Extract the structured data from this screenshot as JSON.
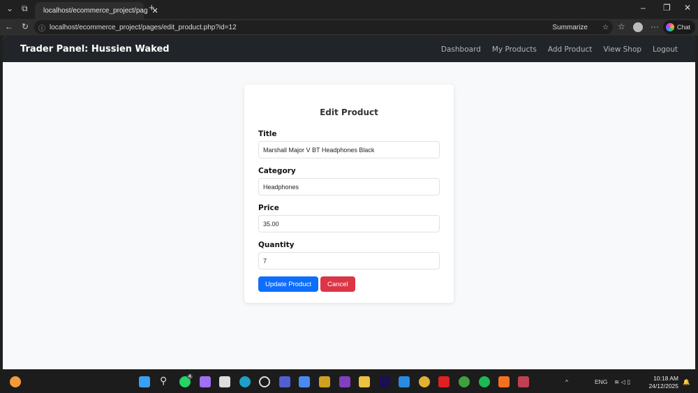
{
  "browser": {
    "tab_title": "localhost/ecommerce_project/pag",
    "url": "localhost/ecommerce_project/pages/edit_product.php?id=12",
    "summarize": "Summarize",
    "chat": "Chat"
  },
  "nav": {
    "brand": "Trader Panel: Hussien Waked",
    "links": [
      "Dashboard",
      "My Products",
      "Add Product",
      "View Shop",
      "Logout"
    ]
  },
  "form": {
    "title": "Edit Product",
    "fields": [
      {
        "label": "Title",
        "value": "Marshall Major V BT Headphones Black"
      },
      {
        "label": "Category",
        "value": "Headphones"
      },
      {
        "label": "Price",
        "value": "35.00"
      },
      {
        "label": "Quantity",
        "value": "7"
      }
    ],
    "update": "Update Product",
    "cancel": "Cancel"
  },
  "taskbar": {
    "lang": "ENG",
    "time": "10:18 AM",
    "date": "24/12/2025",
    "whatsapp_badge": "4"
  }
}
